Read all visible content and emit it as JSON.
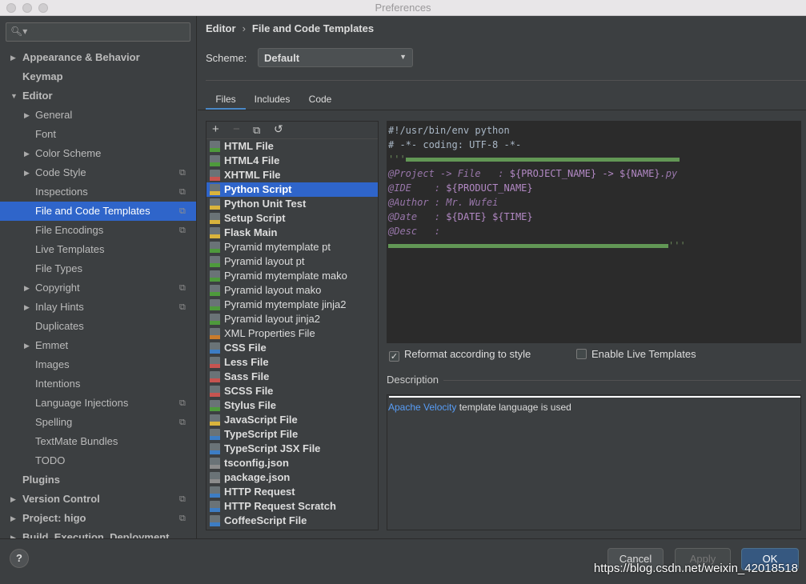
{
  "window": {
    "title": "Preferences"
  },
  "search": {
    "placeholder": ""
  },
  "sidebar": {
    "items": [
      {
        "label": "Appearance & Behavior",
        "bold": true,
        "arrow": "right",
        "indent": 0
      },
      {
        "label": "Keymap",
        "bold": true,
        "indent": 0
      },
      {
        "label": "Editor",
        "bold": true,
        "arrow": "down",
        "indent": 0
      },
      {
        "label": "General",
        "arrow": "right",
        "indent": 1
      },
      {
        "label": "Font",
        "indent": 1
      },
      {
        "label": "Color Scheme",
        "arrow": "right",
        "indent": 1
      },
      {
        "label": "Code Style",
        "arrow": "right",
        "indent": 1,
        "copy": true
      },
      {
        "label": "Inspections",
        "indent": 1,
        "copy": true
      },
      {
        "label": "File and Code Templates",
        "indent": 1,
        "copy": true,
        "selected": true
      },
      {
        "label": "File Encodings",
        "indent": 1,
        "copy": true
      },
      {
        "label": "Live Templates",
        "indent": 1
      },
      {
        "label": "File Types",
        "indent": 1
      },
      {
        "label": "Copyright",
        "arrow": "right",
        "indent": 1,
        "copy": true
      },
      {
        "label": "Inlay Hints",
        "arrow": "right",
        "indent": 1,
        "copy": true
      },
      {
        "label": "Duplicates",
        "indent": 1
      },
      {
        "label": "Emmet",
        "arrow": "right",
        "indent": 1
      },
      {
        "label": "Images",
        "indent": 1
      },
      {
        "label": "Intentions",
        "indent": 1
      },
      {
        "label": "Language Injections",
        "indent": 1,
        "copy": true
      },
      {
        "label": "Spelling",
        "indent": 1,
        "copy": true
      },
      {
        "label": "TextMate Bundles",
        "indent": 1
      },
      {
        "label": "TODO",
        "indent": 1
      },
      {
        "label": "Plugins",
        "bold": true,
        "indent": 0
      },
      {
        "label": "Version Control",
        "bold": true,
        "arrow": "right",
        "indent": 0,
        "copy": true
      },
      {
        "label": "Project: higo",
        "bold": true,
        "arrow": "right",
        "indent": 0,
        "copy": true
      },
      {
        "label": "Build, Execution, Deployment",
        "bold": true,
        "arrow": "right",
        "indent": 0
      }
    ]
  },
  "breadcrumb": {
    "parent": "Editor",
    "sep": "›",
    "current": "File and Code Templates"
  },
  "scheme": {
    "label": "Scheme:",
    "value": "Default"
  },
  "tabs": [
    {
      "label": "Files",
      "active": true
    },
    {
      "label": "Includes"
    },
    {
      "label": "Code"
    }
  ],
  "toolbar": {
    "add": "+",
    "remove": "−",
    "copy": "⧉",
    "reset": "↺"
  },
  "files": [
    {
      "label": "HTML File",
      "bold": true,
      "color": "#4e9a3c"
    },
    {
      "label": "HTML4 File",
      "bold": true,
      "color": "#4e9a3c"
    },
    {
      "label": "XHTML File",
      "bold": true,
      "color": "#c75450"
    },
    {
      "label": "Python Script",
      "bold": true,
      "color": "#d9b43c",
      "selected": true
    },
    {
      "label": "Python Unit Test",
      "bold": true,
      "color": "#d9b43c"
    },
    {
      "label": "Setup Script",
      "bold": true,
      "color": "#d9b43c"
    },
    {
      "label": "Flask Main",
      "bold": true,
      "color": "#d9b43c"
    },
    {
      "label": "Pyramid mytemplate pt",
      "color": "#4e9a3c"
    },
    {
      "label": "Pyramid layout pt",
      "color": "#4e9a3c"
    },
    {
      "label": "Pyramid mytemplate mako",
      "color": "#4e9a3c"
    },
    {
      "label": "Pyramid layout mako",
      "color": "#4e9a3c"
    },
    {
      "label": "Pyramid mytemplate jinja2",
      "color": "#4e9a3c"
    },
    {
      "label": "Pyramid layout jinja2",
      "color": "#4e9a3c"
    },
    {
      "label": "XML Properties File",
      "color": "#c97c2c"
    },
    {
      "label": "CSS File",
      "bold": true,
      "color": "#3d7dc4"
    },
    {
      "label": "Less File",
      "bold": true,
      "color": "#c75450"
    },
    {
      "label": "Sass File",
      "bold": true,
      "color": "#c75450"
    },
    {
      "label": "SCSS File",
      "bold": true,
      "color": "#c75450"
    },
    {
      "label": "Stylus File",
      "bold": true,
      "color": "#4e9a3c"
    },
    {
      "label": "JavaScript File",
      "bold": true,
      "color": "#d9b43c"
    },
    {
      "label": "TypeScript File",
      "bold": true,
      "color": "#3d7dc4"
    },
    {
      "label": "TypeScript JSX File",
      "bold": true,
      "color": "#3d7dc4"
    },
    {
      "label": "tsconfig.json",
      "bold": true,
      "color": "#8c8c8c"
    },
    {
      "label": "package.json",
      "bold": true,
      "color": "#8c8c8c"
    },
    {
      "label": "HTTP Request",
      "bold": true,
      "color": "#3d7dc4"
    },
    {
      "label": "HTTP Request Scratch",
      "bold": true,
      "color": "#3d7dc4"
    },
    {
      "label": "CoffeeScript File",
      "bold": true,
      "color": "#3d7dc4"
    }
  ],
  "editor": {
    "line1": "#!/usr/bin/env python",
    "line2": "# -*- coding: UTF-8 -*-",
    "quote": "'''",
    "k_project": "@Project -> File   :",
    "v_project": "${PROJECT_NAME} -> ${NAME}",
    "v_ext": ".py",
    "k_ide": "@IDE    :",
    "v_ide": "${PRODUCT_NAME}",
    "k_author": "@Author :",
    "v_author": "Mr. Wufei",
    "k_date": "@Date   :",
    "v_date": "${DATE} ${TIME}",
    "k_desc": "@Desc   :"
  },
  "options": {
    "reformat": "Reformat according to style",
    "reformat_checked": true,
    "live": "Enable Live Templates",
    "live_checked": false
  },
  "description": {
    "label": "Description",
    "link": "Apache Velocity",
    "text": " template language is used"
  },
  "buttons": {
    "help": "?",
    "cancel": "Cancel",
    "apply": "Apply",
    "ok": "OK"
  },
  "watermark": "https://blog.csdn.net/weixin_42018518"
}
